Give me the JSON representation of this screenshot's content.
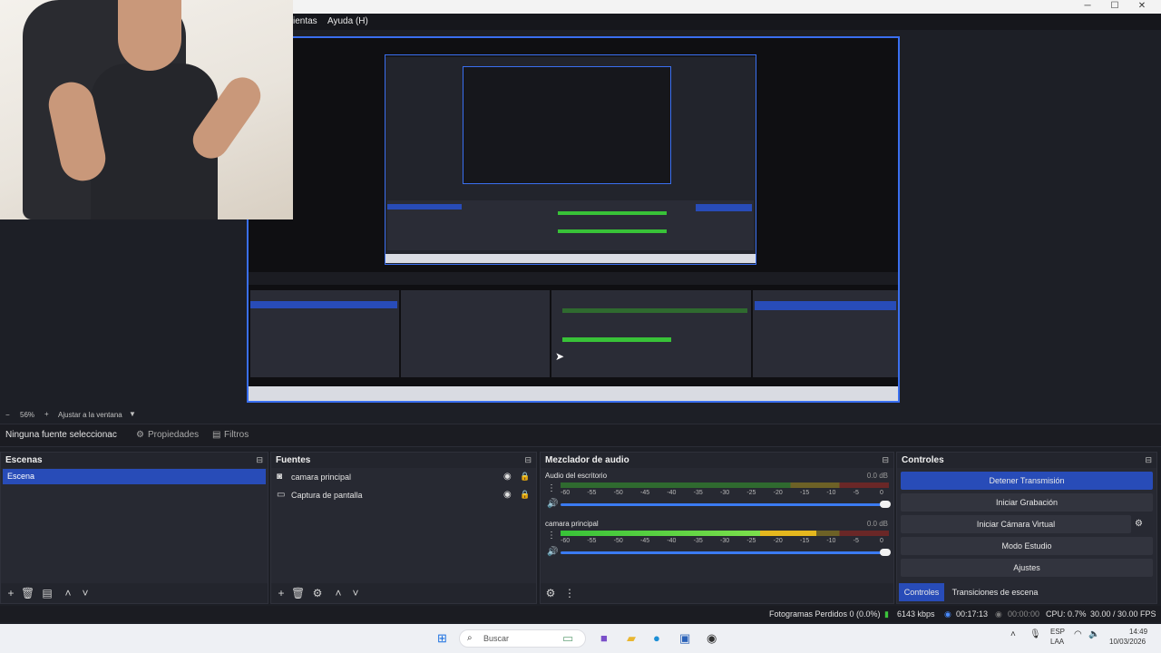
{
  "window": {
    "menu": [
      "ientas",
      "Ayuda (H)"
    ]
  },
  "preview": {
    "zoom": "56%",
    "fit_label": "Ajustar a la ventana"
  },
  "source_toolbar": {
    "no_source": "Ninguna fuente seleccionac",
    "properties": "Propiedades",
    "filters": "Filtros"
  },
  "scenes": {
    "title": "Escenas",
    "items": [
      "Escena"
    ]
  },
  "sources": {
    "title": "Fuentes",
    "items": [
      {
        "label": "camara principal",
        "icon": "camera-icon"
      },
      {
        "label": "Captura de pantalla",
        "icon": "monitor-icon"
      }
    ]
  },
  "mixer": {
    "title": "Mezclador de audio",
    "channels": [
      {
        "name": "Audio del escritorio",
        "db": "0.0 dB",
        "level": 0.0
      },
      {
        "name": "camara principal",
        "db": "0.0 dB",
        "level": 0.78
      }
    ],
    "scale": [
      "-60",
      "-55",
      "-50",
      "-45",
      "-40",
      "-35",
      "-30",
      "-25",
      "-20",
      "-15",
      "-10",
      "-5",
      "0"
    ]
  },
  "controls": {
    "title": "Controles",
    "buttons": [
      "Detener Transmisión",
      "Iniciar Grabación",
      "Iniciar Cámara Virtual",
      "Modo Estudio",
      "Ajustes"
    ],
    "tabs": [
      "Controles",
      "Transiciones de escena"
    ]
  },
  "status": {
    "dropped": "Fotogramas Perdidos 0 (0.0%)",
    "bitrate": "6143 kbps",
    "stream_time": "00:17:13",
    "rec_time": "00:00:00",
    "cpu": "CPU: 0.7%",
    "fps": "30.00 / 30.00 FPS"
  },
  "taskbar": {
    "search_placeholder": "Buscar",
    "lang_top": "ESP",
    "lang_bottom": "LAA",
    "time": "14:49",
    "date": "10/03/2026"
  },
  "colors": {
    "accent": "#284cb8",
    "dock_bg": "#272932",
    "meter_green": "#38c238",
    "meter_yellow": "#e5b71e",
    "meter_red": "#6a2727"
  }
}
